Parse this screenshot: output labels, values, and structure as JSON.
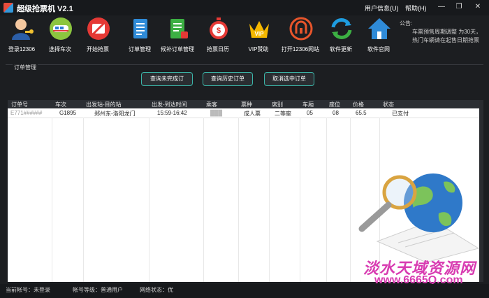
{
  "app": {
    "title": "超级抢票机 V2.1"
  },
  "menu": {
    "user_info": "用户信息(U)",
    "help": "帮助(H)"
  },
  "toolbar": {
    "items": [
      {
        "label": "登录12306",
        "icon": "user-login-icon"
      },
      {
        "label": "选择车次",
        "icon": "train-icon"
      },
      {
        "label": "开始抢票",
        "icon": "ticket-start-icon"
      },
      {
        "label": "订单管理",
        "icon": "order-doc-icon"
      },
      {
        "label": "候补订单管理",
        "icon": "waitlist-order-icon"
      },
      {
        "label": "抢票日历",
        "icon": "stopwatch-icon"
      },
      {
        "label": "VIP赞助",
        "icon": "vip-crown-icon"
      },
      {
        "label": "打开12306网站",
        "icon": "railway-logo-icon"
      },
      {
        "label": "软件更新",
        "icon": "update-icon"
      },
      {
        "label": "软件官网",
        "icon": "home-icon"
      }
    ]
  },
  "notice": {
    "title": "公告:",
    "text": "车票预售周期调整 为30天，热门车辆请在起售日期抢票"
  },
  "order_panel": {
    "title": "订单管理",
    "buttons": [
      "查询未完成订",
      "查询历史订单",
      "取消选中订单"
    ]
  },
  "table": {
    "columns": [
      "订单号",
      "车次",
      "出发站-目的站",
      "出发-到达时间",
      "乘客",
      "票种",
      "席别",
      "车厢",
      "座位",
      "价格",
      "状态"
    ],
    "rows": [
      [
        "E771######",
        "G1895",
        "郑州东-洛阳龙门",
        "15:59-16:42",
        "███",
        "成人票",
        "二等座",
        "05",
        "08",
        "65.5",
        "已支付"
      ]
    ]
  },
  "watermark": {
    "line1": "淡水天域资源网",
    "line2": "www.6665Q.com"
  },
  "status": {
    "account": "当前帐号：未登录",
    "level": "帐号等级：普通用户",
    "network": "网络状态：优"
  }
}
